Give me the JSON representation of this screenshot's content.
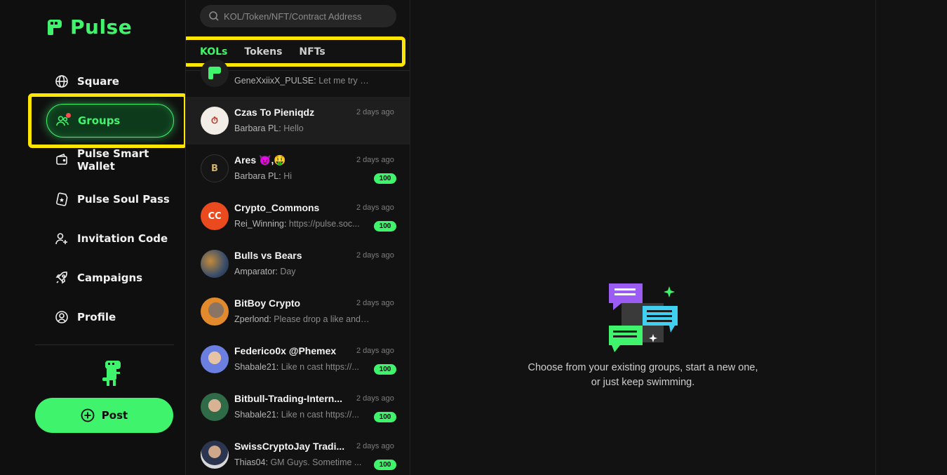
{
  "app": {
    "name": "Pulse",
    "accent": "#3ff46c",
    "highlight": "#ffe600"
  },
  "sidebar": {
    "items": [
      {
        "label": "Square",
        "icon": "globe-icon"
      },
      {
        "label": "Groups",
        "icon": "users-icon",
        "active": true,
        "has_notification": true
      },
      {
        "label": "Pulse Smart Wallet",
        "icon": "wallet-icon"
      },
      {
        "label": "Pulse Soul Pass",
        "icon": "soul-pass-icon"
      },
      {
        "label": "Invitation Code",
        "icon": "user-plus-icon"
      },
      {
        "label": "Campaigns",
        "icon": "rocket-icon"
      },
      {
        "label": "Profile",
        "icon": "profile-icon"
      }
    ],
    "post_label": "Post"
  },
  "search": {
    "placeholder": "KOL/Token/NFT/Contract Address"
  },
  "tabs": [
    {
      "label": "KOLs",
      "active": true
    },
    {
      "label": "Tokens"
    },
    {
      "label": "NFTs"
    }
  ],
  "groups": [
    {
      "title": "",
      "time": "",
      "sender": "GeneXxiixX_PULSE:",
      "preview": "Let me try this ...",
      "badge": "",
      "avatar_color": "#1f1f1f",
      "avatar_text": ""
    },
    {
      "title": "Czas To Pieniqdz",
      "time": "2 days ago",
      "sender": "Barbara PL:",
      "preview": "Hello",
      "badge": "",
      "avatar_color": "#f2ede6",
      "avatar_text": "⏱"
    },
    {
      "title": "Ares 😈,🤑",
      "time": "2 days ago",
      "sender": "Barbara PL:",
      "preview": "Hi",
      "badge": "100",
      "avatar_color": "#151515",
      "avatar_text": "B"
    },
    {
      "title": "Crypto_Commons",
      "time": "2 days ago",
      "sender": "Rei_Winning:",
      "preview": "https://pulse.soc...",
      "badge": "100",
      "avatar_color": "#ea4a1d",
      "avatar_text": "CC"
    },
    {
      "title": "Bulls vs Bears",
      "time": "2 days ago",
      "sender": "Amparator:",
      "preview": "Day",
      "badge": "",
      "avatar_color": "#3a4e6b",
      "avatar_text": ""
    },
    {
      "title": "BitBoy Crypto",
      "time": "2 days ago",
      "sender": "Zperlond:",
      "preview": "Please drop a like and co...",
      "badge": "",
      "avatar_color": "#e38a2c",
      "avatar_text": ""
    },
    {
      "title": "Federico0x @Phemex",
      "time": "2 days ago",
      "sender": "Shabale21:",
      "preview": "Like n cast https://...",
      "badge": "100",
      "avatar_color": "#6b7fe0",
      "avatar_text": ""
    },
    {
      "title": "Bitbull-Trading-Intern...",
      "time": "2 days ago",
      "sender": "Shabale21:",
      "preview": "Like n cast https://...",
      "badge": "100",
      "avatar_color": "#2f6b47",
      "avatar_text": ""
    },
    {
      "title": "SwissCryptoJay Tradi...",
      "time": "2 days ago",
      "sender": "Thias04:",
      "preview": "GM Guys. Sometime ...",
      "badge": "100",
      "avatar_color": "#d9d9d9",
      "avatar_text": ""
    }
  ],
  "empty_state": {
    "line1": "Choose from your existing groups, start a new one,",
    "line2": "or just keep swimming."
  }
}
